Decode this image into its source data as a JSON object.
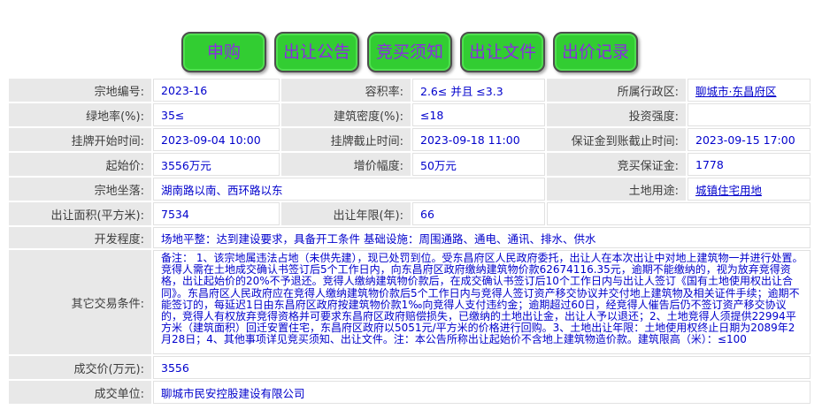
{
  "colors": {
    "button_bg": "#32cd32",
    "button_text": "#8a2be2",
    "label_bg": "#e8e8e8",
    "value_text": "#0000cc"
  },
  "toolbar": {
    "buttons": [
      "申购",
      "出让公告",
      "竞买须知",
      "出让文件",
      "出价记录"
    ]
  },
  "table": {
    "rows": [
      {
        "cells": [
          "宗地编号:",
          "2023-16",
          "容积率:",
          "2.6≤ 并且 ≤3.3",
          "所属行政区:",
          "聊城市·东昌府区"
        ]
      },
      {
        "cells": [
          "绿地率(%):",
          "35≤",
          "建筑密度(%):",
          "≤18",
          "投资强度:",
          ""
        ]
      },
      {
        "cells": [
          "挂牌开始时间:",
          "2023-09-04 10:00",
          "挂牌截止时间:",
          "2023-09-18 11:00",
          "保证金到账截止时间:",
          "2023-09-15 17:00"
        ]
      },
      {
        "cells": [
          "起始价:",
          "3556万元",
          "增价幅度:",
          "50万元",
          "竞买保证金:",
          "1778"
        ]
      },
      {
        "cells": [
          "宗地坐落:",
          "湖南路以南、西环路以东",
          "土地用途:",
          "城镇住宅用地"
        ]
      },
      {
        "cells": [
          "出让面积(平方米):",
          "7534",
          "出让年限(年):",
          "66",
          ""
        ]
      },
      {
        "cells": [
          "开发程度:",
          "场地平整：达到建设要求，具备开工条件 基础设施：周围通路、通电、通讯、排水、供水"
        ]
      },
      {
        "cells": [
          "其它交易条件:",
          "备注： 1、该宗地属违法占地（未供先建），现已处罚到位。受东昌府区人民政府委托，出让人在本次出让中对地上建筑物一并进行处置。竞得人需在土地成交确认书签订后5个工作日内，向东昌府区政府缴纳建筑物价款62674116.35元，逾期不能缴纳的，视为放弃竞得资格，出让起始价的20%不予退还。竞得人缴纳建筑物价款后，在成交确认书签订后10个工作日内与出让人签订《国有土地使用权出让合同》。东昌府区人民政府应在竞得人缴纳建筑物价款后5个工作日内与竞得人签订资产移交协议并交付地上建筑物及相关证件手续；逾期不能签订的，每延迟1日由东昌府区政府按建筑物价款1‰向竞得人支付违约金；逾期超过60日，经竞得人催告后仍不签订资产移交协议的，竞得人有权放弃竞得资格并可要求东昌府区政府赔偿损失，已缴纳的土地出让金，出让人予以退还；2、土地竞得人须提供22994平方米（建筑面积）回迁安置住宅，东昌府区政府以5051元/平方米的价格进行回购。3、土地出让年限：土地使用权终止日期为2089年2月28日；4、其他事项详见竞买须知、出让文件。注：本公告所称出让起始价不含地上建筑物造价款。建筑限高（米）：≤100"
        ]
      },
      {
        "cells": [
          "成交价(万元):",
          "3556"
        ]
      },
      {
        "cells": [
          "成交单位:",
          "聊城市民安控股建设有限公司"
        ]
      }
    ]
  }
}
